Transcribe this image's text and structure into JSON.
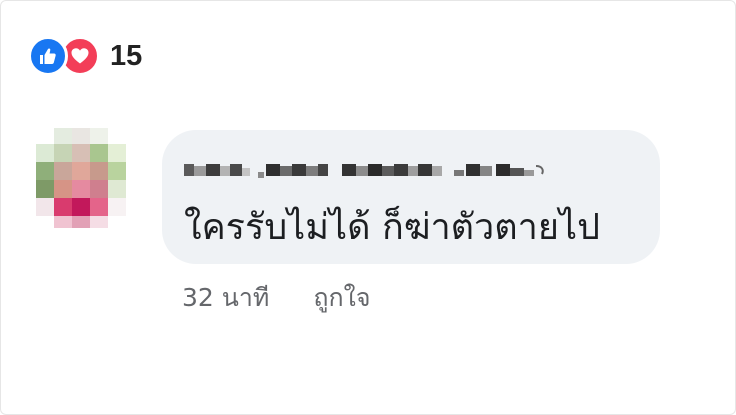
{
  "reactions": {
    "icons": [
      "like-icon",
      "love-icon"
    ],
    "count": "15",
    "colors": {
      "like": "#1877f2",
      "love": "#f33e58"
    }
  },
  "comment": {
    "author_redacted": true,
    "text": "ใครรับไม่ได้  ก็ฆ่าตัวตายไป",
    "time": "32 นาที",
    "like_action": "ถูกใจ"
  },
  "colors": {
    "bubble": "#eff2f5",
    "text": "#1c1e21",
    "meta": "#65676b"
  }
}
